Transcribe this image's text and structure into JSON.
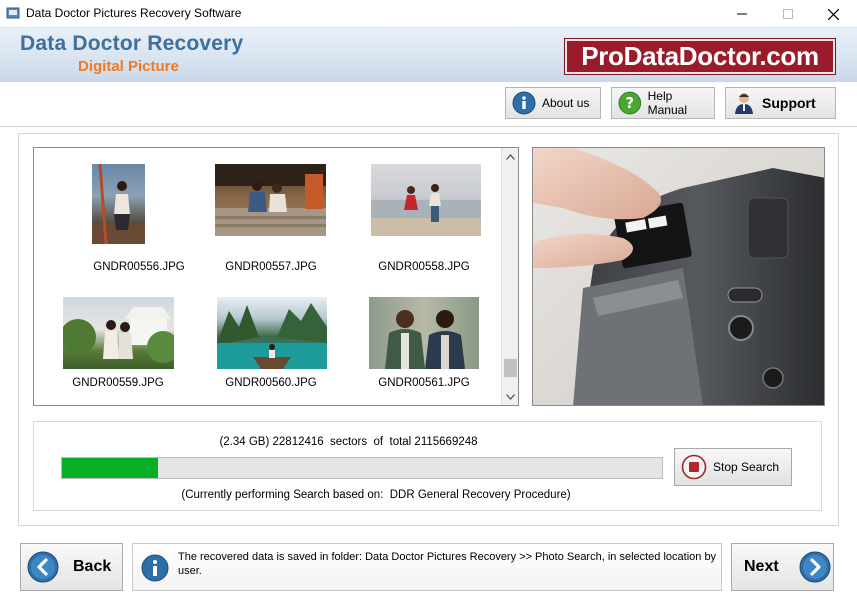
{
  "window": {
    "title": "Data Doctor Pictures Recovery Software",
    "minimize_glyph": "—",
    "maximize_glyph": "☐",
    "close_glyph": "✕"
  },
  "banner": {
    "title": "Data Doctor Recovery",
    "subtitle": "Digital Picture",
    "brand": "ProDataDoctor.com"
  },
  "toolbar": {
    "about_label": "About us",
    "help_label": "Help Manual",
    "support_label": "Support"
  },
  "thumbnails": [
    {
      "label": "GNDR00556.JPG"
    },
    {
      "label": "GNDR00557.JPG"
    },
    {
      "label": "GNDR00558.JPG"
    },
    {
      "label": "GNDR00559.JPG"
    },
    {
      "label": "GNDR00560.JPG"
    },
    {
      "label": "GNDR00561.JPG"
    }
  ],
  "progress": {
    "sectors_text": "(2.34 GB) 22812416  sectors  of  total 2115669248",
    "percent": 16,
    "status_text": "(Currently performing Search based on:  DDR General Recovery Procedure)",
    "stop_label": "Stop Search"
  },
  "footer": {
    "back_label": "Back",
    "next_label": "Next",
    "info_text": "The recovered data is saved in folder: Data Doctor Pictures Recovery  >> Photo Search, in selected location by user."
  },
  "colors": {
    "accent_blue": "#2f6fa8",
    "progress_green": "#06b025",
    "brand_red": "#9a1c2b",
    "subtitle_orange": "#f07a22"
  },
  "icons": {
    "about": "info-icon",
    "help": "help-question-icon",
    "support": "support-person-icon",
    "stop": "stop-icon",
    "back": "arrow-left-icon",
    "next": "arrow-right-icon",
    "info": "info-icon"
  }
}
